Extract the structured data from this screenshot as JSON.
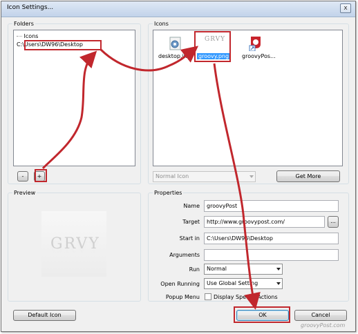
{
  "window": {
    "title": "Icon Settings...",
    "close_glyph": "x"
  },
  "folders": {
    "label": "Folders",
    "tree_root": "Icons",
    "selected_path": "C:\\Users\\DW96\\Desktop",
    "remove_label": "-",
    "add_label": "+"
  },
  "icons": {
    "label": "Icons",
    "items": [
      {
        "name": "desktop.ini",
        "icon": "gear-settings-icon"
      },
      {
        "name": "groovy.png",
        "icon": "grvy-logo-icon",
        "selected": true
      },
      {
        "name": "groovyPos...",
        "icon": "groovypost-logo-icon"
      }
    ],
    "type_select": "Normal Icon",
    "get_more_label": "Get More"
  },
  "preview": {
    "label": "Preview",
    "logo_text": "GRVY"
  },
  "properties": {
    "label": "Properties",
    "name_label": "Name",
    "name_value": "groovyPost",
    "target_label": "Target",
    "target_value": "http://www.groovypost.com/",
    "browse_label": "...",
    "start_in_label": "Start in",
    "start_in_value": "C:\\Users\\DW96\\Desktop",
    "arguments_label": "Arguments",
    "arguments_value": "",
    "run_label": "Run",
    "run_value": "Normal",
    "open_running_label": "Open Running",
    "open_running_value": "Use Global Setting",
    "popup_menu_label": "Popup Menu",
    "display_special_label": "Display Special Actions",
    "display_special_checked": false
  },
  "footer": {
    "default_icon_label": "Default Icon",
    "ok_label": "OK",
    "cancel_label": "Cancel",
    "watermark": "groovyPost.com"
  },
  "colors": {
    "annotation_red": "#c1272d",
    "selection_blue": "#3399ff"
  }
}
